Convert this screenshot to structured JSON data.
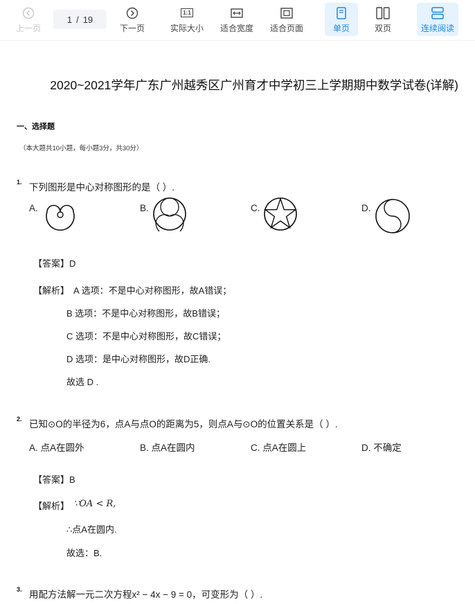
{
  "toolbar": {
    "prev_label": "上一页",
    "page_current": "1",
    "page_sep": "/",
    "page_total": "19",
    "next_label": "下一页",
    "actual_size_label": "实际大小",
    "actual_size_icon_text": "1:1",
    "fit_width_label": "适合宽度",
    "fit_page_label": "适合页面",
    "single_label": "单页",
    "double_label": "双页",
    "continuous_label": "连续阅读",
    "accent_color": "#1e88e5",
    "active_bg": "#e6f3ff"
  },
  "doc": {
    "title": "2020~2021学年广东广州越秀区广州育才中学初三上学期期中数学试卷(详解)",
    "section_title": "一、选择题",
    "section_note": "（本大题共10小题，每小题3分，共30分）",
    "q1": {
      "num": "1.",
      "text": "下列图形是中心对称图形的是（  ）.",
      "options": [
        "A.",
        "B.",
        "C.",
        "D."
      ],
      "answer": "【答案】D",
      "analysis_label": "【解析】",
      "analysis_lines": [
        "A 选项：不是中心对称图形，故A错误；",
        "B 选项：不是中心对称图形，故B错误；",
        "C 选项：不是中心对称图形，故C错误；",
        "D 选项：是中心对称图形，故D正确.",
        "故选 D ."
      ]
    },
    "q2": {
      "num": "2.",
      "text": "已知⊙O的半径为6，点A与点O的距离为5，则点A与⊙O的位置关系是（  ）.",
      "options": [
        "A. 点A在圆外",
        "B. 点A在圆内",
        "C. 点A在圆上",
        "D. 不确定"
      ],
      "answer": "【答案】B",
      "analysis_label": "【解析】",
      "analysis_lines": [
        "∵OA < R,",
        "∴点A在圆内.",
        "故选：B."
      ]
    },
    "q3": {
      "num": "3.",
      "text": "用配方法解一元二次方程x² − 4x − 9 = 0，可变形为（  ）."
    }
  }
}
